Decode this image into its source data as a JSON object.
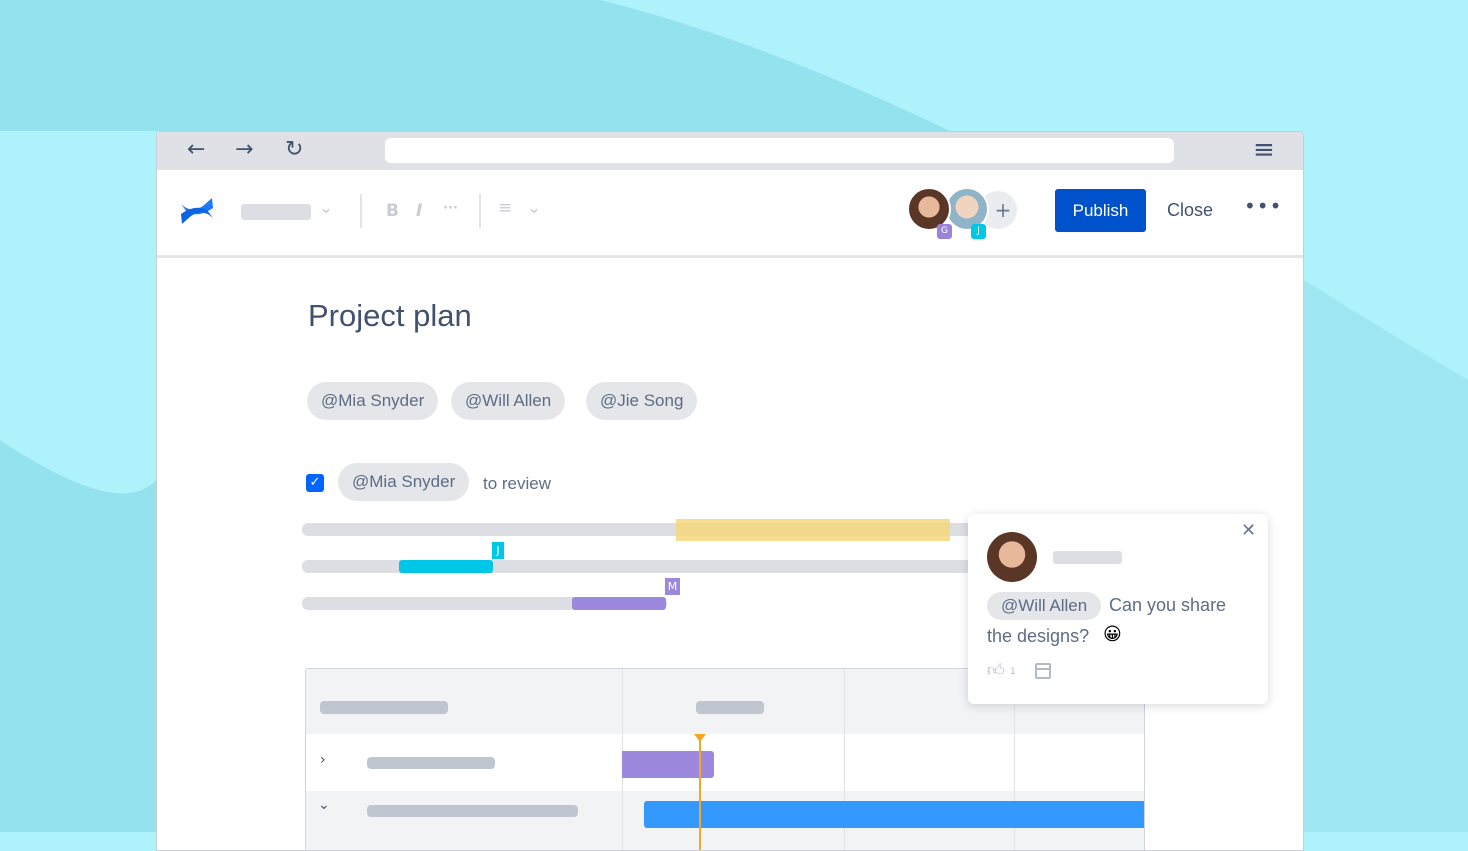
{
  "browser": {
    "back_icon": "←",
    "forward_icon": "→",
    "reload_icon": "↻",
    "menu_icon": "≡"
  },
  "toolbar": {
    "bold": "B",
    "italic": "I",
    "more": "···",
    "align_icon": "≡",
    "chevron": "⌄",
    "publish_label": "Publish",
    "close_label": "Close",
    "more_label": "•••",
    "add_collaborator": "+",
    "collaborators": [
      {
        "initial": "G",
        "color": "#9c82dc"
      },
      {
        "initial": "J",
        "color": "#00c7e6"
      }
    ]
  },
  "page": {
    "title": "Project plan",
    "mentions": [
      "@Mia Snyder",
      "@Will Allen",
      "@Jie Song"
    ],
    "task": {
      "checked": true,
      "mention": "@Mia Snyder",
      "text": "to review"
    },
    "timeline_markers": [
      {
        "label": "J",
        "color": "#00c7e6"
      },
      {
        "label": "M",
        "color": "#9c88dc"
      }
    ]
  },
  "comment": {
    "close_icon": "✕",
    "mention": "@Will Allen",
    "text_1": "Can you share",
    "text_2": "the designs?",
    "emoji": "😀",
    "like_count": "1"
  },
  "colors": {
    "accent": "#0052cc",
    "highlight": "#f5d77b",
    "cyan": "#00c7e6",
    "purple": "#9c88dc",
    "blue": "#3399ff",
    "today": "#f5a623"
  }
}
